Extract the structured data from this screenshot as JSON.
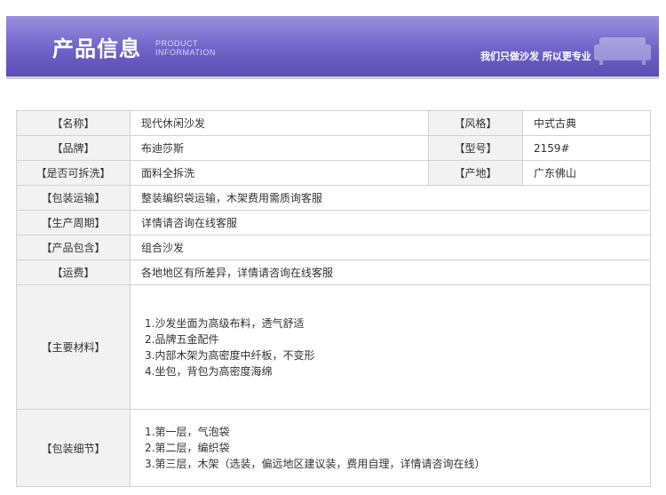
{
  "header": {
    "title": "产品信息",
    "en_line1": "PRODUCT",
    "en_line2": "INFORMATION",
    "slogan": "我们只做沙发 所以更专业"
  },
  "specs": {
    "name_label": "【名称】",
    "name": "现代休闲沙发",
    "style_label": "【风格】",
    "style": "中式古典",
    "brand_label": "【品牌】",
    "brand": "布迪莎斯",
    "model_label": "【型号】",
    "model": "2159#",
    "removable_label": "【是否可拆洗】",
    "removable": "面料全拆洗",
    "origin_label": "【产地】",
    "origin": "广东佛山",
    "shipping_label": "【包装运输】",
    "shipping": "整装编织袋运输，木架费用需质询客服",
    "cycle_label": "【生产周期】",
    "cycle": "详情请咨询在线客服",
    "includes_label": "【产品包含】",
    "includes": "组合沙发",
    "freight_label": "【运费】",
    "freight": "各地地区有所差异，详情请咨询在线客服",
    "materials_label": "【主要材料】",
    "materials": [
      "1.沙发坐面为高级布料，透气舒适",
      "2.品牌五金配件",
      "3.内部木架为高密度中纤板，不变形",
      "4.坐包，背包为高密度海绵"
    ],
    "packing_label": "【包装细节】",
    "packing": [
      "1.第一层，气泡袋",
      "2.第二层，编织袋",
      "3.第三层，木架（选装，偏远地区建议装，费用自理，详情请咨询在线）"
    ]
  }
}
